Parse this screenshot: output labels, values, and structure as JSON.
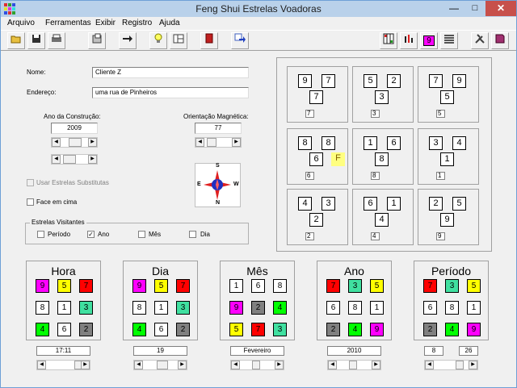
{
  "window": {
    "title": "Feng Shui Estrelas Voadoras"
  },
  "menu": [
    "Arquivo",
    "Ferramentas",
    "Exibir",
    "Registro",
    "Ajuda"
  ],
  "form": {
    "nome_label": "Nome:",
    "nome_value": "Cliente Z",
    "endereco_label": "Endereço:",
    "endereco_value": "uma rua de Pinheiros",
    "ano_label": "Ano da Construção:",
    "ano_value": "2009",
    "orient_label": "Orientação Magnética:",
    "orient_value": "77",
    "usar_label": "Usar Estrelas Substitutas",
    "face_label": "Face em cima",
    "visitantes_label": "Estrelas Visitantes",
    "opts": [
      "Período",
      "Ano",
      "Mês",
      "Dia"
    ]
  },
  "compass": {
    "n": "N",
    "s": "S",
    "e": "E",
    "w": "W"
  },
  "grid": [
    {
      "m": "9",
      "w": "7",
      "c": "7",
      "s": "7"
    },
    {
      "m": "5",
      "w": "2",
      "c": "3",
      "s": "3"
    },
    {
      "m": "7",
      "w": "9",
      "c": "5",
      "s": "5"
    },
    {
      "m": "8",
      "w": "8",
      "c": "6",
      "s": "6",
      "f": "F"
    },
    {
      "m": "1",
      "w": "6",
      "c": "8",
      "s": "8"
    },
    {
      "m": "3",
      "w": "4",
      "c": "1",
      "s": "1"
    },
    {
      "m": "4",
      "w": "3",
      "c": "2",
      "s": "2"
    },
    {
      "m": "6",
      "w": "1",
      "c": "4",
      "s": "4"
    },
    {
      "m": "2",
      "w": "5",
      "c": "9",
      "s": "9"
    }
  ],
  "panels": [
    {
      "title": "Hora",
      "value": "17:11",
      "nums": [
        "9",
        "5",
        "7",
        "8",
        "1",
        "3",
        "4",
        "6",
        "2"
      ],
      "colors": [
        "#ff00ff",
        "#ffff00",
        "#ff0000",
        "#ffffff",
        "#ffffff",
        "#40e0a0",
        "#00ff00",
        "#ffffff",
        "#808080"
      ]
    },
    {
      "title": "Dia",
      "value": "19",
      "nums": [
        "9",
        "5",
        "7",
        "8",
        "1",
        "3",
        "4",
        "6",
        "2"
      ],
      "colors": [
        "#ff00ff",
        "#ffff00",
        "#ff0000",
        "#ffffff",
        "#ffffff",
        "#40e0a0",
        "#00ff00",
        "#ffffff",
        "#808080"
      ]
    },
    {
      "title": "Mês",
      "value": "Fevereiro",
      "nums": [
        "1",
        "6",
        "8",
        "9",
        "2",
        "4",
        "5",
        "7",
        "3"
      ],
      "colors": [
        "#ffffff",
        "#ffffff",
        "#ffffff",
        "#ff00ff",
        "#808080",
        "#00ff00",
        "#ffff00",
        "#ff0000",
        "#40e0a0"
      ]
    },
    {
      "title": "Ano",
      "value": "2010",
      "nums": [
        "7",
        "3",
        "5",
        "6",
        "8",
        "1",
        "2",
        "4",
        "9"
      ],
      "colors": [
        "#ff0000",
        "#40e0a0",
        "#ffff00",
        "#ffffff",
        "#ffffff",
        "#ffffff",
        "#808080",
        "#00ff00",
        "#ff00ff"
      ]
    },
    {
      "title": "Período",
      "value_a": "8",
      "value_b": "26",
      "nums": [
        "7",
        "3",
        "5",
        "6",
        "8",
        "1",
        "2",
        "4",
        "9"
      ],
      "colors": [
        "#ff0000",
        "#40e0a0",
        "#ffff00",
        "#ffffff",
        "#ffffff",
        "#ffffff",
        "#808080",
        "#00ff00",
        "#ff00ff"
      ]
    }
  ],
  "toolbar_icons": [
    "open-folder-icon",
    "save-icon",
    "print-icon",
    "report-icon",
    "arrow-right-icon",
    "lightbulb-icon",
    "layout-icon",
    "book-icon",
    "export-icon",
    "grid-icon",
    "bars-icon",
    "nine-icon",
    "lines-icon",
    "tools-icon",
    "help-book-icon"
  ]
}
